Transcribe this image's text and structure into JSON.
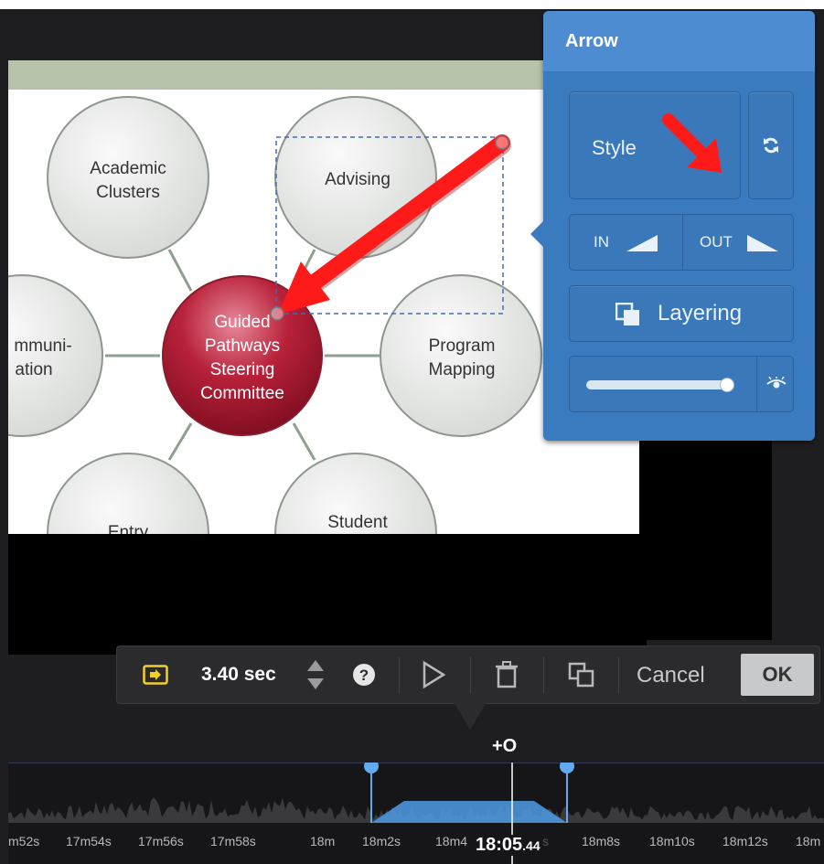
{
  "slide": {
    "nodes": {
      "academic": [
        "Academic",
        "Clusters"
      ],
      "advising": [
        "Advising"
      ],
      "communication": [
        "mmuni-",
        "ation"
      ],
      "program": [
        "Program",
        "Mapping"
      ],
      "entry": [
        "Entry"
      ],
      "student": [
        "Student"
      ],
      "center": [
        "Guided",
        "Pathways",
        "Steering",
        "Committee"
      ]
    }
  },
  "popup": {
    "title": "Arrow",
    "style_label": "Style",
    "in_label": "IN",
    "out_label": "OUT",
    "layering_label": "Layering",
    "opacity": 0.95,
    "accent": "#3a7bbf"
  },
  "toolbar": {
    "duration": "3.40 sec",
    "cancel_label": "Cancel",
    "ok_label": "OK"
  },
  "timeline": {
    "ticks": [
      "m52s",
      "17m54s",
      "17m56s",
      "17m58s",
      "18m",
      "18m2s",
      "18m4",
      "18m6s",
      "18m8s",
      "18m10s",
      "18m12s",
      "18m"
    ],
    "playhead_main": "18:05",
    "playhead_frac": ".44",
    "add_marker": "+O"
  }
}
